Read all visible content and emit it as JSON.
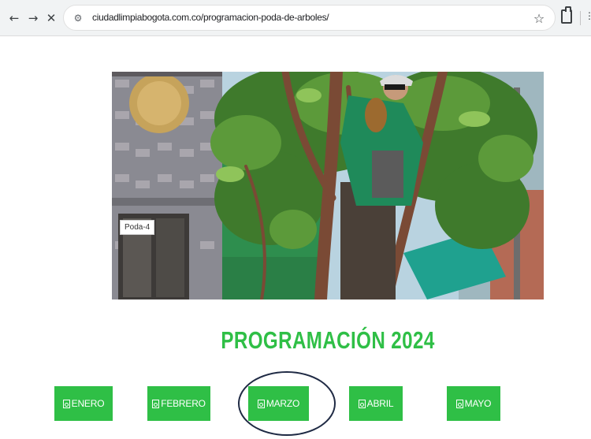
{
  "browser": {
    "url": "ciudadlimpiabogota.com.co/programacion-poda-de-arboles/",
    "back_icon": "arrow-left-icon",
    "forward_icon": "arrow-right-icon",
    "stop_icon": "close-icon"
  },
  "hero": {
    "caption": "Poda-4"
  },
  "page": {
    "title": "PROGRAMACIÓN 2024"
  },
  "months": [
    {
      "label": "ENERO"
    },
    {
      "label": "FEBRERO"
    },
    {
      "label": "MARZO"
    },
    {
      "label": "ABRIL"
    },
    {
      "label": "MAYO"
    }
  ],
  "colors": {
    "accent_green": "#2fbf46",
    "highlight_ring": "#1f2a44"
  }
}
